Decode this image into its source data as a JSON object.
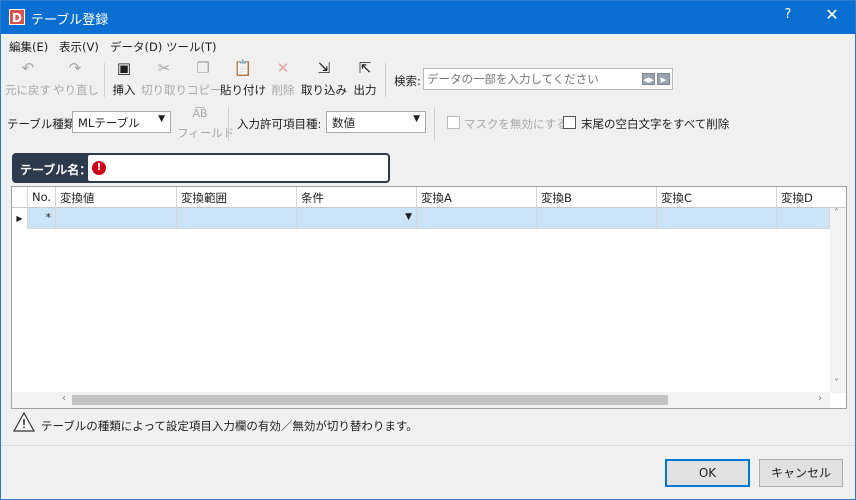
{
  "window": {
    "title": "テーブル登録",
    "app_icon_letter": "D",
    "help": "?",
    "close": "✕"
  },
  "menu": [
    "編集(E)",
    "表示(V)",
    "データ(D)",
    "ツール(T)"
  ],
  "toolbar": {
    "undo": "元に戻す",
    "redo": "やり直し",
    "insert": "挿入",
    "cut": "切り取り",
    "copy": "コピー",
    "paste": "貼り付け",
    "delete": "削除",
    "import": "取り込み",
    "export": "出力",
    "search_label": "検索:",
    "search_placeholder": "データの一部を入力してください"
  },
  "options": {
    "table_type_label": "テーブル種類:",
    "table_type_value": "MLテーブル",
    "field_label": "フィールド",
    "input_allowed_label": "入力許可項目種:",
    "input_allowed_value": "数値",
    "mask_disable": "マスクを無効にする",
    "trim_trailing": "末尾の空白文字をすべて削除"
  },
  "table_name": {
    "label": "テーブル名：",
    "value": "",
    "error_icon": "!"
  },
  "grid": {
    "columns": [
      "No.",
      "変換値",
      "変換範囲",
      "条件",
      "変換A",
      "変換B",
      "変換C",
      "変換D"
    ],
    "new_row_marker": "*"
  },
  "status": {
    "message": "テーブルの種類によって設定項目入力欄の有効／無効が切り替わります。"
  },
  "buttons": {
    "ok": "OK",
    "cancel": "キャンセル"
  }
}
